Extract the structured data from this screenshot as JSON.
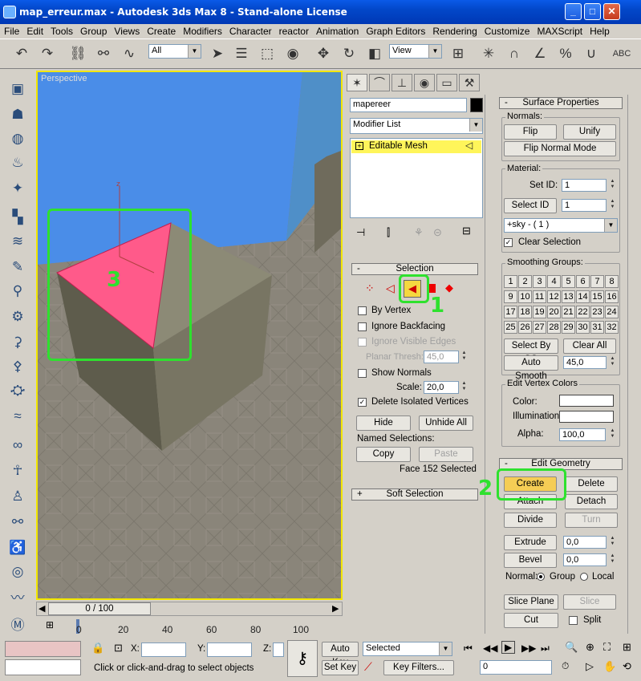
{
  "window": {
    "title": "map_erreur.max - Autodesk 3ds Max 8  - Stand-alone License"
  },
  "menu": [
    "File",
    "Edit",
    "Tools",
    "Group",
    "Views",
    "Create",
    "Modifiers",
    "Character",
    "reactor",
    "Animation",
    "Graph Editors",
    "Rendering",
    "Customize",
    "MAXScript",
    "Help"
  ],
  "toolbar": {
    "selection_filter": "All",
    "ref_coord": "View"
  },
  "viewport": {
    "label": "Perspective",
    "annotation_label": "3"
  },
  "modify_panel": {
    "object_name": "mapereer",
    "modifier_list": "Modifier List",
    "stack_item": "Editable Mesh"
  },
  "selection": {
    "title": "Selection",
    "by_vertex": "By Vertex",
    "ignore_backfacing": "Ignore Backfacing",
    "ignore_visible_edges": "Ignore Visible Edges",
    "planar_thresh_label": "Planar Thresh:",
    "planar_thresh": "45,0",
    "show_normals": "Show Normals",
    "scale_label": "Scale:",
    "scale": "20,0",
    "delete_isolated": "Delete Isolated Vertices",
    "hide": "Hide",
    "unhide_all": "Unhide All",
    "named_selections": "Named Selections:",
    "copy": "Copy",
    "paste": "Paste",
    "status": "Face 152 Selected",
    "annotation_label": "1"
  },
  "soft_selection": {
    "title": "Soft Selection"
  },
  "surface": {
    "title": "Surface Properties",
    "normals": "Normals:",
    "flip": "Flip",
    "unify": "Unify",
    "flip_normal_mode": "Flip Normal Mode",
    "material": "Material:",
    "set_id_label": "Set ID:",
    "set_id": "1",
    "select_id": "Select ID",
    "select_id_value": "1",
    "material_name": "+sky - ( 1 )",
    "clear_selection": "Clear Selection",
    "smoothing": "Smoothing Groups:",
    "sg": [
      "1",
      "2",
      "3",
      "4",
      "5",
      "6",
      "7",
      "8",
      "9",
      "10",
      "11",
      "12",
      "13",
      "14",
      "15",
      "16",
      "17",
      "18",
      "19",
      "20",
      "21",
      "22",
      "23",
      "24",
      "25",
      "26",
      "27",
      "28",
      "29",
      "30",
      "31",
      "32"
    ],
    "select_by_sg": "Select By SG",
    "clear_all": "Clear All",
    "auto_smooth": "Auto Smooth",
    "auto_smooth_value": "45,0",
    "vertex_colors": "Edit Vertex Colors",
    "color": "Color:",
    "illumination": "Illumination:",
    "alpha_label": "Alpha:",
    "alpha": "100,0"
  },
  "edit_geometry": {
    "title": "Edit Geometry",
    "create": "Create",
    "delete": "Delete",
    "attach": "Attach",
    "detach": "Detach",
    "divide": "Divide",
    "turn": "Turn",
    "extrude": "Extrude",
    "extrude_value": "0,0",
    "bevel": "Bevel",
    "bevel_value": "0,0",
    "normal_label": "Normal:",
    "group": "Group",
    "local": "Local",
    "slice_plane": "Slice Plane",
    "slice": "Slice",
    "cut": "Cut",
    "split": "Split",
    "annotation_label": "2"
  },
  "timeline": {
    "frame": "0 / 100",
    "ticks": [
      "0",
      "20",
      "40",
      "60",
      "80",
      "100"
    ]
  },
  "status": {
    "x_label": "X:",
    "y_label": "Y:",
    "z_label": "Z:",
    "auto_key": "Auto Key",
    "selected": "Selected",
    "set_key": "Set Key",
    "key_filters": "Key Filters...",
    "frame_value": "0",
    "prompt": "Click or click-and-drag to select objects"
  }
}
